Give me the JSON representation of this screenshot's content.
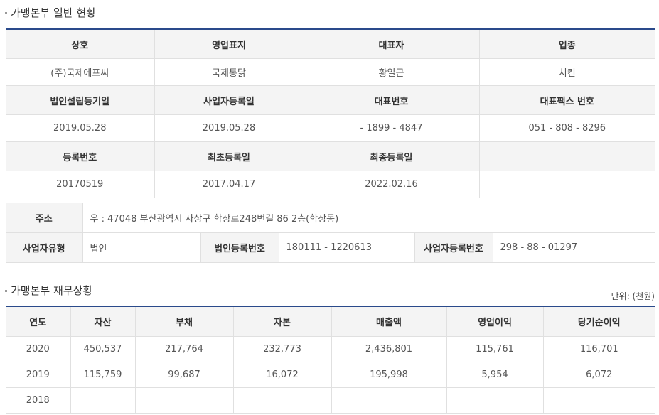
{
  "section1": {
    "title": "가맹본부 일반 현황",
    "rows": [
      {
        "type": "header",
        "cells": [
          "상호",
          "영업표지",
          "대표자",
          "업종"
        ]
      },
      {
        "type": "data",
        "cells": [
          "(주)국제에프씨",
          "국제통닭",
          "황일근",
          "치킨"
        ]
      },
      {
        "type": "header",
        "cells": [
          "법인설립등기일",
          "사업자등록일",
          "대표번호",
          "대표팩스 번호"
        ]
      },
      {
        "type": "data",
        "cells": [
          "2019.05.28",
          "2019.05.28",
          "- 1899 - 4847",
          "051 - 808 - 8296"
        ]
      },
      {
        "type": "header",
        "cells": [
          "등록번호",
          "최초등록일",
          "최종등록일",
          ""
        ]
      },
      {
        "type": "data",
        "cells": [
          "20170519",
          "2017.04.17",
          "2022.02.16",
          ""
        ]
      }
    ]
  },
  "address": {
    "label": "주소",
    "value": "우 : 47048 부산광역시 사상구 학장로248번길 86 2층(학장동)",
    "biz_type_label": "사업자유형",
    "biz_type_value": "법인",
    "corp_reg_label": "법인등록번호",
    "corp_reg_value": "180111 - 1220613",
    "biz_reg_label": "사업자등록번호",
    "biz_reg_value": "298 - 88 - 01297"
  },
  "section2": {
    "title": "가맹본부 재무상황",
    "unit": "단위: (천원)",
    "headers": [
      "연도",
      "자산",
      "부채",
      "자본",
      "매출액",
      "영업이익",
      "당기순이익"
    ],
    "rows": [
      [
        "2020",
        "450,537",
        "217,764",
        "232,773",
        "2,436,801",
        "115,761",
        "116,701"
      ],
      [
        "2019",
        "115,759",
        "99,687",
        "16,072",
        "195,998",
        "5,954",
        "6,072"
      ],
      [
        "2018",
        "",
        "",
        "",
        "",
        "",
        ""
      ]
    ]
  }
}
